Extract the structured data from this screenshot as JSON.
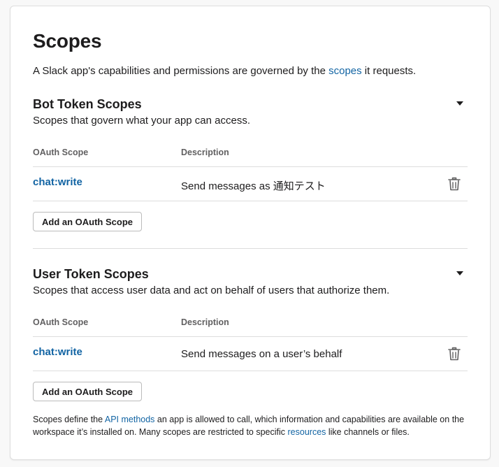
{
  "page": {
    "title": "Scopes",
    "intro_prefix": "A Slack app's capabilities and permissions are governed by the ",
    "intro_link": "scopes",
    "intro_suffix": " it requests."
  },
  "bot_section": {
    "title": "Bot Token Scopes",
    "subtitle": "Scopes that govern what your app can access.",
    "col_scope": "OAuth Scope",
    "col_desc": "Description",
    "rows": [
      {
        "scope": "chat:write",
        "description": "Send messages as 通知テスト"
      }
    ],
    "add_button": "Add an OAuth Scope"
  },
  "user_section": {
    "title": "User Token Scopes",
    "subtitle": "Scopes that access user data and act on behalf of users that authorize them.",
    "col_scope": "OAuth Scope",
    "col_desc": "Description",
    "rows": [
      {
        "scope": "chat:write",
        "description": "Send messages on a user’s behalf"
      }
    ],
    "add_button": "Add an OAuth Scope"
  },
  "footer": {
    "part1": "Scopes define the ",
    "link1": "API methods",
    "part2": " an app is allowed to call, which information and capabilities are available on the workspace it’s installed on. Many scopes are restricted to specific ",
    "link2": "resources",
    "part3": " like channels or files."
  },
  "icons": {
    "collapse": "caret-down-icon",
    "remove": "trash-icon"
  },
  "colors": {
    "link": "#1264a3",
    "text": "#1d1c1d",
    "muted": "#616061",
    "border": "#dddddd"
  }
}
